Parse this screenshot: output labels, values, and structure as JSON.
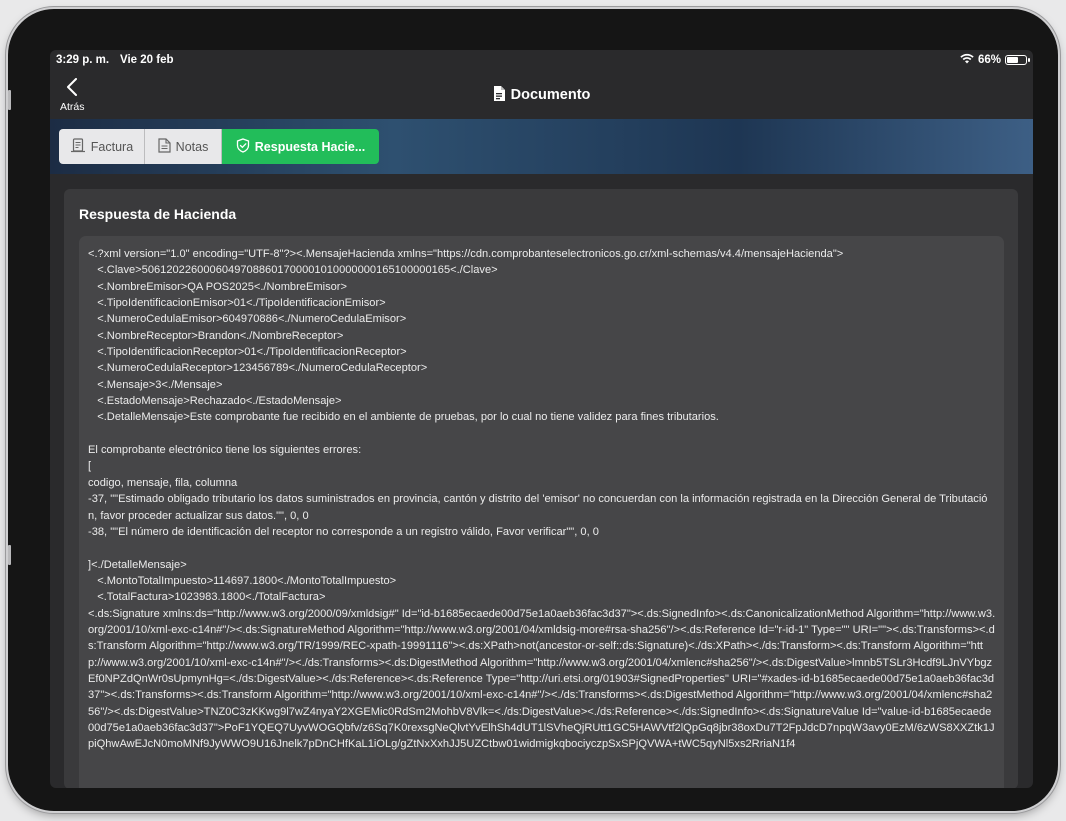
{
  "status_bar": {
    "time": "3:29 p. m.",
    "date": "Vie 20 feb",
    "battery": "66%",
    "battery_level": 0.66
  },
  "nav": {
    "back_label": "Atrás",
    "title": "Documento"
  },
  "tabs": [
    {
      "label": "Factura",
      "icon": "invoice-icon",
      "active": false
    },
    {
      "label": "Notas",
      "icon": "notes-icon",
      "active": false
    },
    {
      "label": "Respuesta Hacie...",
      "icon": "shield-check-icon",
      "active": true
    }
  ],
  "colors": {
    "active_tab": "#22bd5a",
    "background": "#2a2a2c",
    "card": "#3a3a3c",
    "code_box": "#464648"
  },
  "card": {
    "title": "Respuesta de Hacienda",
    "xml": "<.?xml version=\"1.0\" encoding=\"UTF-8\"?><.MensajeHacienda xmlns=\"https://cdn.comprobanteselectronicos.go.cr/xml-schemas/v4.4/mensajeHacienda\">\n   <.Clave>50612022600060497088601700001010000000165100000165<./Clave>\n   <.NombreEmisor>QA POS2025<./NombreEmisor>\n   <.TipoIdentificacionEmisor>01<./TipoIdentificacionEmisor>\n   <.NumeroCedulaEmisor>604970886<./NumeroCedulaEmisor>\n   <.NombreReceptor>Brandon<./NombreReceptor>\n   <.TipoIdentificacionReceptor>01<./TipoIdentificacionReceptor>\n   <.NumeroCedulaReceptor>123456789<./NumeroCedulaReceptor>\n   <.Mensaje>3<./Mensaje>\n   <.EstadoMensaje>Rechazado<./EstadoMensaje>\n   <.DetalleMensaje>Este comprobante fue recibido en el ambiente de pruebas, por lo cual no tiene validez para fines tributarios.\n\nEl comprobante electrónico tiene los siguientes errores:\n[\ncodigo, mensaje, fila, columna\n-37, \"\"Estimado obligado tributario los datos suministrados en provincia, cantón y distrito del 'emisor' no concuerdan con la información registrada en la Dirección General de Tributación, favor proceder actualizar sus datos.\"\", 0, 0\n-38, \"\"El número de identificación del receptor no corresponde a un registro válido, Favor verificar\"\", 0, 0\n\n]<./DetalleMensaje>\n   <.MontoTotalImpuesto>114697.1800<./MontoTotalImpuesto>\n   <.TotalFactura>1023983.1800<./TotalFactura>\n<.ds:Signature xmlns:ds=\"http://www.w3.org/2000/09/xmldsig#\" Id=\"id-b1685ecaede00d75e1a0aeb36fac3d37\"><.ds:SignedInfo><.ds:CanonicalizationMethod Algorithm=\"http://www.w3.org/2001/10/xml-exc-c14n#\"/><.ds:SignatureMethod Algorithm=\"http://www.w3.org/2001/04/xmldsig-more#rsa-sha256\"/><.ds:Reference Id=\"r-id-1\" Type=\"\" URI=\"\"><.ds:Transforms><.ds:Transform Algorithm=\"http://www.w3.org/TR/1999/REC-xpath-19991116\"><.ds:XPath>not(ancestor-or-self::ds:Signature)<./ds:XPath><./ds:Transform><.ds:Transform Algorithm=\"http://www.w3.org/2001/10/xml-exc-c14n#\"/><./ds:Transforms><.ds:DigestMethod Algorithm=\"http://www.w3.org/2001/04/xmlenc#sha256\"/><.ds:DigestValue>lmnb5TSLr3Hcdf9LJnVYbgzEf0NPZdQnWr0sUpmynHg=<./ds:DigestValue><./ds:Reference><.ds:Reference Type=\"http://uri.etsi.org/01903#SignedProperties\" URI=\"#xades-id-b1685ecaede00d75e1a0aeb36fac3d37\"><.ds:Transforms><.ds:Transform Algorithm=\"http://www.w3.org/2001/10/xml-exc-c14n#\"/><./ds:Transforms><.ds:DigestMethod Algorithm=\"http://www.w3.org/2001/04/xmlenc#sha256\"/><.ds:DigestValue>TNZ0C3zKKwg9l7wZ4nyaY2XGEMic0RdSm2MohbV8Vlk=<./ds:DigestValue><./ds:Reference><./ds:SignedInfo><.ds:SignatureValue Id=\"value-id-b1685ecaede00d75e1a0aeb36fac3d37\">PoF1YQEQ7UyvWOGQbfv/z6Sq7K0rexsgNeQlvtYvElhSh4dUT1lSVheQjRUtt1GC5HAWVtf2lQpGq8jbr38oxDu7T2FpJdcD7npqW3avy0EzM/6zWS8XXZtk1JpiQhwAwEJcN0moMNf9JyWWO9U16Jnelk7pDnCHfKaL1iOLg/gZtNxXxhJJ5UZCtbw01widmigkqbociyczpSxSPjQVWA+tWC5qyNl5xs2RriaN1f4"
  }
}
